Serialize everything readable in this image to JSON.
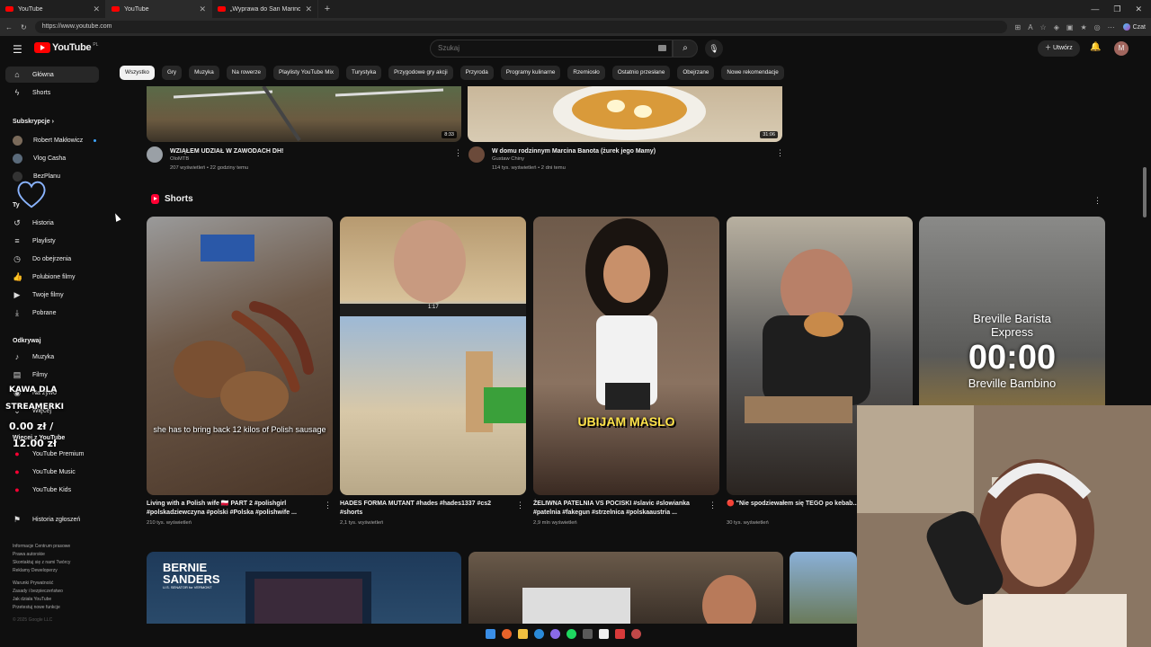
{
  "browser": {
    "tabs": [
      {
        "title": "YouTube"
      },
      {
        "title": "YouTube"
      },
      {
        "title": "„Wyprawa do San Marino” - ROBE"
      }
    ],
    "new_tab": "+",
    "url": "https://www.youtube.com"
  },
  "copilot_label": "Czat",
  "header": {
    "logo_text": "YouTube",
    "logo_country": "PL",
    "search_placeholder": "Szukaj",
    "create_label": "Utwórz",
    "avatar_letter": "M"
  },
  "sidebar": {
    "main": [
      {
        "label": "Główna",
        "icon": "home-icon"
      },
      {
        "label": "Shorts",
        "icon": "shorts-icon"
      }
    ],
    "subscriptions_title": "Subskrypcje",
    "subscriptions": [
      {
        "label": "Robert Makłowicz"
      },
      {
        "label": "Vlog Casha"
      },
      {
        "label": "BezPlanu"
      }
    ],
    "you_title": "Ty",
    "you_items": [
      {
        "label": "Historia",
        "icon": "history-icon"
      },
      {
        "label": "Playlisty",
        "icon": "playlist-icon"
      },
      {
        "label": "Do obejrzenia",
        "icon": "watch-later-icon"
      },
      {
        "label": "Polubione filmy",
        "icon": "like-icon"
      },
      {
        "label": "Twoje filmy",
        "icon": "your-videos-icon"
      },
      {
        "label": "Pobrane",
        "icon": "download-icon"
      }
    ],
    "explore_title": "Odkrywaj",
    "explore_items": [
      {
        "label": "Muzyka",
        "icon": "music-icon"
      },
      {
        "label": "Filmy",
        "icon": "film-icon"
      },
      {
        "label": "Na żywo",
        "icon": "live-icon"
      },
      {
        "label": "Więcej",
        "icon": "chevron-down-icon"
      }
    ],
    "more_title": "Więcej z YouTube",
    "more_items": [
      {
        "label": "YouTube Premium"
      },
      {
        "label": "YouTube Music"
      },
      {
        "label": "YouTube Kids"
      }
    ],
    "report_history": "Historia zgłoszeń",
    "footer_lines": [
      "Informacje  Centrum prasowe",
      "Prawa autorskie",
      "Skontaktuj się z nami  Twórcy",
      "Reklamy  Deweloperzy",
      "",
      "Warunki  Prywatność",
      "Zasady i bezpieczeństwo",
      "Jak działa YouTube",
      "Przetestuj nowe funkcje",
      "",
      "© 2025 Google LLC"
    ]
  },
  "stream_overlay": {
    "line1": "KAWA DLA",
    "line2": "STREAMERKI",
    "amount": "0.00 zł /",
    "goal": "12.00 zł"
  },
  "chips": [
    "Wszystko",
    "Gry",
    "Muzyka",
    "Na rowerze",
    "Playlisty YouTube Mix",
    "Turystyka",
    "Przygodowe gry akcji",
    "Przyroda",
    "Programy kulinarne",
    "Rzemiosło",
    "Ostatnio przesłane",
    "Obejrzane",
    "Nowe rekomendacje"
  ],
  "top_videos": [
    {
      "title": "WZIĄŁEM UDZIAŁ W ZAWODACH DH!",
      "channel": "OloMTB",
      "stats": "207 wyświetleń • 22 godziny temu",
      "duration": "8:33"
    },
    {
      "title": "W domu rodzinnym Marcina Banota (żurek jego Mamy)",
      "channel": "Gustaw Chiny",
      "stats": "114 tys. wyświetleń • 2 dni temu",
      "duration": "31:06"
    }
  ],
  "shorts_title": "Shorts",
  "shorts": [
    {
      "title": "Living with a Polish wife 🇵🇱 PART 2 #polishgirl #polskadziewczyna #polski #Polska #polishwife ...",
      "views": "210 tys. wyświetleń",
      "caption": "she has to bring back 12 kilos of Polish sausage"
    },
    {
      "title": "HADES FORMA MUTANT #hades #hades1337 #cs2 #shorts",
      "views": "2,1 tys. wyświetleń",
      "hud": "1:17"
    },
    {
      "title": "ŻELIWNA PATELNIA VS POCISKI #slavic #slowianka #patelnia #fakegun #strzelnica #polskaaustria ...",
      "views": "2,9 mln wyświetleń",
      "caption": "UBIJAM MASLO"
    },
    {
      "title": "🔴 \"Nie spodziewałem się TEGO po kebab... Bielin... 🌮🔖",
      "views": "30 tys. wyświetleń"
    },
    {
      "brand1": "Breville Barista",
      "brand2": "Express",
      "timer": "00:00",
      "brand3": "Breville Bambino"
    }
  ],
  "bottom_videos": [
    {
      "brand": "BERNIE",
      "brand2": "SANDERS",
      "brand3": "U.S. SENATOR for VERMONT"
    }
  ]
}
